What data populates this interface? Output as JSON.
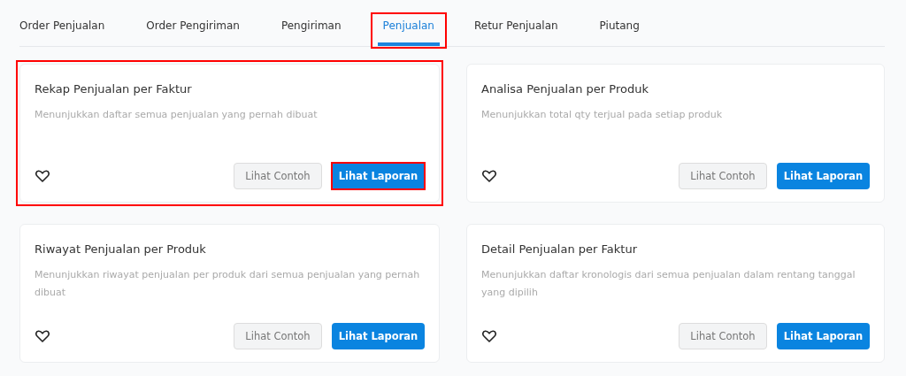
{
  "tabs": [
    {
      "label": "Order Penjualan",
      "selected": false,
      "highlighted": false
    },
    {
      "label": "Order Pengiriman",
      "selected": false,
      "highlighted": false
    },
    {
      "label": "Pengiriman",
      "selected": false,
      "highlighted": false
    },
    {
      "label": "Penjualan",
      "selected": true,
      "highlighted": true
    },
    {
      "label": "Retur Penjualan",
      "selected": false,
      "highlighted": false
    },
    {
      "label": "Piutang",
      "selected": false,
      "highlighted": false
    }
  ],
  "reports": [
    {
      "title": "Rekap Penjualan per Faktur",
      "description": "Menunjukkan daftar semua penjualan yang pernah dibuat",
      "highlighted": true,
      "example_button": "Lihat Contoh",
      "report_button": "Lihat Laporan",
      "report_button_highlighted": true
    },
    {
      "title": "Analisa Penjualan per Produk",
      "description": "Menunjukkan total qty terjual pada setiap produk",
      "highlighted": false,
      "example_button": "Lihat Contoh",
      "report_button": "Lihat Laporan",
      "report_button_highlighted": false
    },
    {
      "title": "Riwayat Penjualan per Produk",
      "description": "Menunjukkan riwayat penjualan per produk dari semua penjualan yang pernah dibuat",
      "highlighted": false,
      "example_button": "Lihat Contoh",
      "report_button": "Lihat Laporan",
      "report_button_highlighted": false
    },
    {
      "title": "Detail Penjualan per Faktur",
      "description": "Menunjukkan daftar kronologis dari semua penjualan dalam rentang tanggal yang dipilih",
      "highlighted": false,
      "example_button": "Lihat Contoh",
      "report_button": "Lihat Laporan",
      "report_button_highlighted": false
    }
  ]
}
